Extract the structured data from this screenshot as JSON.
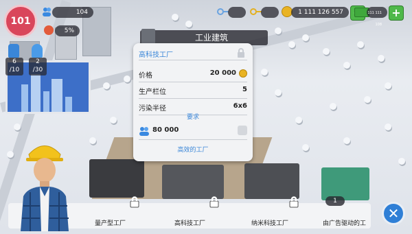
{
  "hud": {
    "level": "101",
    "population": "104",
    "happiness": "5%",
    "water_current": "6",
    "water_cap": "/10",
    "power_current": "2",
    "power_cap": "/30",
    "keys_gold_value": "1 111 126 557",
    "cash_value": "111 111 108"
  },
  "category_title": "工业建筑",
  "panel": {
    "name": "高科技工厂",
    "price_label": "价格",
    "price_value": "20 000",
    "slots_label": "生产栏位",
    "slots_value": "5",
    "pollution_label": "污染半径",
    "pollution_value": "6x6",
    "requirements_title": "要求",
    "requirement_value": "80 000",
    "description": "高效的工厂"
  },
  "buildings": [
    {
      "label": "量产型工厂"
    },
    {
      "label": "高科技工厂"
    },
    {
      "label": "纳米科技工厂"
    },
    {
      "label": "由广告驱动的工",
      "badge": "1"
    }
  ],
  "colors": {
    "accent_green": "#4fb84a",
    "level_badge": "#d9465b",
    "close_blue": "#2f7fd6"
  }
}
